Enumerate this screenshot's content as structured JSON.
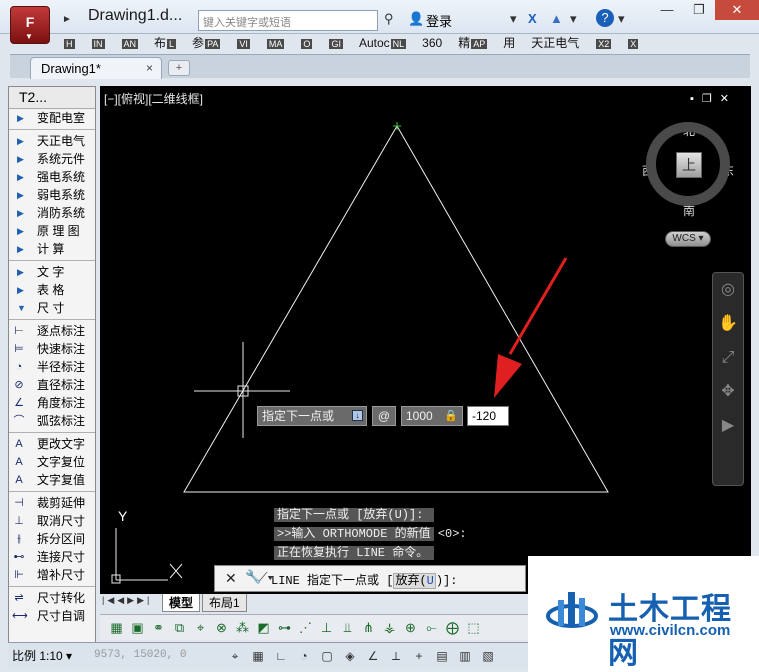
{
  "titlebar": {
    "app_button_label": "F",
    "document_title": "Drawing1.d...",
    "search_placeholder": "键入关键字或短语",
    "login_label": "登录",
    "help_label": "?"
  },
  "ribbon_tabs": [
    {
      "label": "",
      "key": "H"
    },
    {
      "label": "",
      "key": "IN"
    },
    {
      "label": "",
      "key": "AN"
    },
    {
      "label": "布",
      "key": "L"
    },
    {
      "label": "参",
      "key": "PA"
    },
    {
      "label": "",
      "key": "VI"
    },
    {
      "label": "",
      "key": "MA"
    },
    {
      "label": "",
      "key": "O"
    },
    {
      "label": "",
      "key": "GI"
    },
    {
      "label": "Autoc",
      "key": "NL"
    },
    {
      "label": "360",
      "key": ""
    },
    {
      "label": "精",
      "key": "AP"
    },
    {
      "label": "用",
      "key": ""
    },
    {
      "label": "天正电气",
      "key": ""
    },
    {
      "label": "",
      "key": "X2"
    },
    {
      "label": "",
      "key": "X"
    }
  ],
  "file_tabs": {
    "active": "Drawing1*",
    "close": "×",
    "new_tab": "+"
  },
  "palette": {
    "title": "T2...",
    "groups": [
      {
        "items": [
          {
            "label": "变配电室",
            "icon": "triangle-right-icon"
          }
        ]
      },
      {
        "items": [
          {
            "label": "天正电气",
            "icon": "triangle-right-icon"
          },
          {
            "label": "系统元件",
            "icon": "triangle-right-icon"
          },
          {
            "label": "强电系统",
            "icon": "triangle-right-icon"
          },
          {
            "label": "弱电系统",
            "icon": "triangle-right-icon"
          },
          {
            "label": "消防系统",
            "icon": "triangle-right-icon"
          },
          {
            "label": "原 理 图",
            "icon": "triangle-right-icon"
          },
          {
            "label": "计 算",
            "icon": "triangle-right-icon"
          }
        ]
      },
      {
        "items": [
          {
            "label": "文 字",
            "icon": "triangle-right-icon"
          },
          {
            "label": "表 格",
            "icon": "triangle-right-icon"
          },
          {
            "label": "尺 寸",
            "icon": "triangle-down-icon"
          }
        ]
      },
      {
        "items": [
          {
            "label": "逐点标注",
            "icon": "dimension-icon"
          },
          {
            "label": "快速标注",
            "icon": "quick-dimension-icon"
          },
          {
            "label": "半径标注",
            "icon": "radius-icon"
          },
          {
            "label": "直径标注",
            "icon": "diameter-icon"
          },
          {
            "label": "角度标注",
            "icon": "angle-icon"
          },
          {
            "label": "弧弦标注",
            "icon": "arc-icon"
          }
        ]
      },
      {
        "items": [
          {
            "label": "更改文字",
            "icon": "text-edit-icon"
          },
          {
            "label": "文字复位",
            "icon": "text-reset-icon"
          },
          {
            "label": "文字复值",
            "icon": "text-restore-icon"
          }
        ]
      },
      {
        "items": [
          {
            "label": "裁剪延伸",
            "icon": "trim-icon"
          },
          {
            "label": "取消尺寸",
            "icon": "cancel-dimension-icon"
          },
          {
            "label": "拆分区间",
            "icon": "split-icon"
          },
          {
            "label": "连接尺寸",
            "icon": "join-icon"
          },
          {
            "label": "增补尺寸",
            "icon": "add-dimension-icon"
          }
        ]
      },
      {
        "items": [
          {
            "label": "尺寸转化",
            "icon": "convert-icon"
          },
          {
            "label": "尺寸自调",
            "icon": "auto-adjust-icon"
          }
        ]
      }
    ]
  },
  "viewport": {
    "label": "[−][俯视][二维线框]",
    "viewcube_face": "上",
    "compass": {
      "north": "北",
      "south": "南",
      "east": "东",
      "west": "西"
    },
    "wcs_label": "WCS"
  },
  "dynamic_input": {
    "prompt": "指定下一点或",
    "prefix": "@",
    "length": "1000",
    "angle": "-120"
  },
  "command_history": [
    "指定下一点或 [放弃(U)]:",
    ">>输入 ORTHOMODE 的新值 <0>:",
    "正在恢复执行 LINE 命令。"
  ],
  "command_line": {
    "command": "LINE",
    "prompt": "指定下一点或",
    "option_text": "放弃(",
    "option_key": "U",
    "option_tail": ")]:"
  },
  "ucs": {
    "y_label": "Y"
  },
  "layout_tabs": {
    "model": "模型",
    "layout1": "布局1"
  },
  "status_bar": {
    "scale": "比例 1:10",
    "coords": "9573, 15020, 0"
  },
  "watermark": {
    "brand": "土木工程网",
    "url": "www.civilcn.com"
  },
  "colors": {
    "canvas": "#000000",
    "accent_arrow": "#e02020",
    "watermark_blue": "#1560b0"
  }
}
